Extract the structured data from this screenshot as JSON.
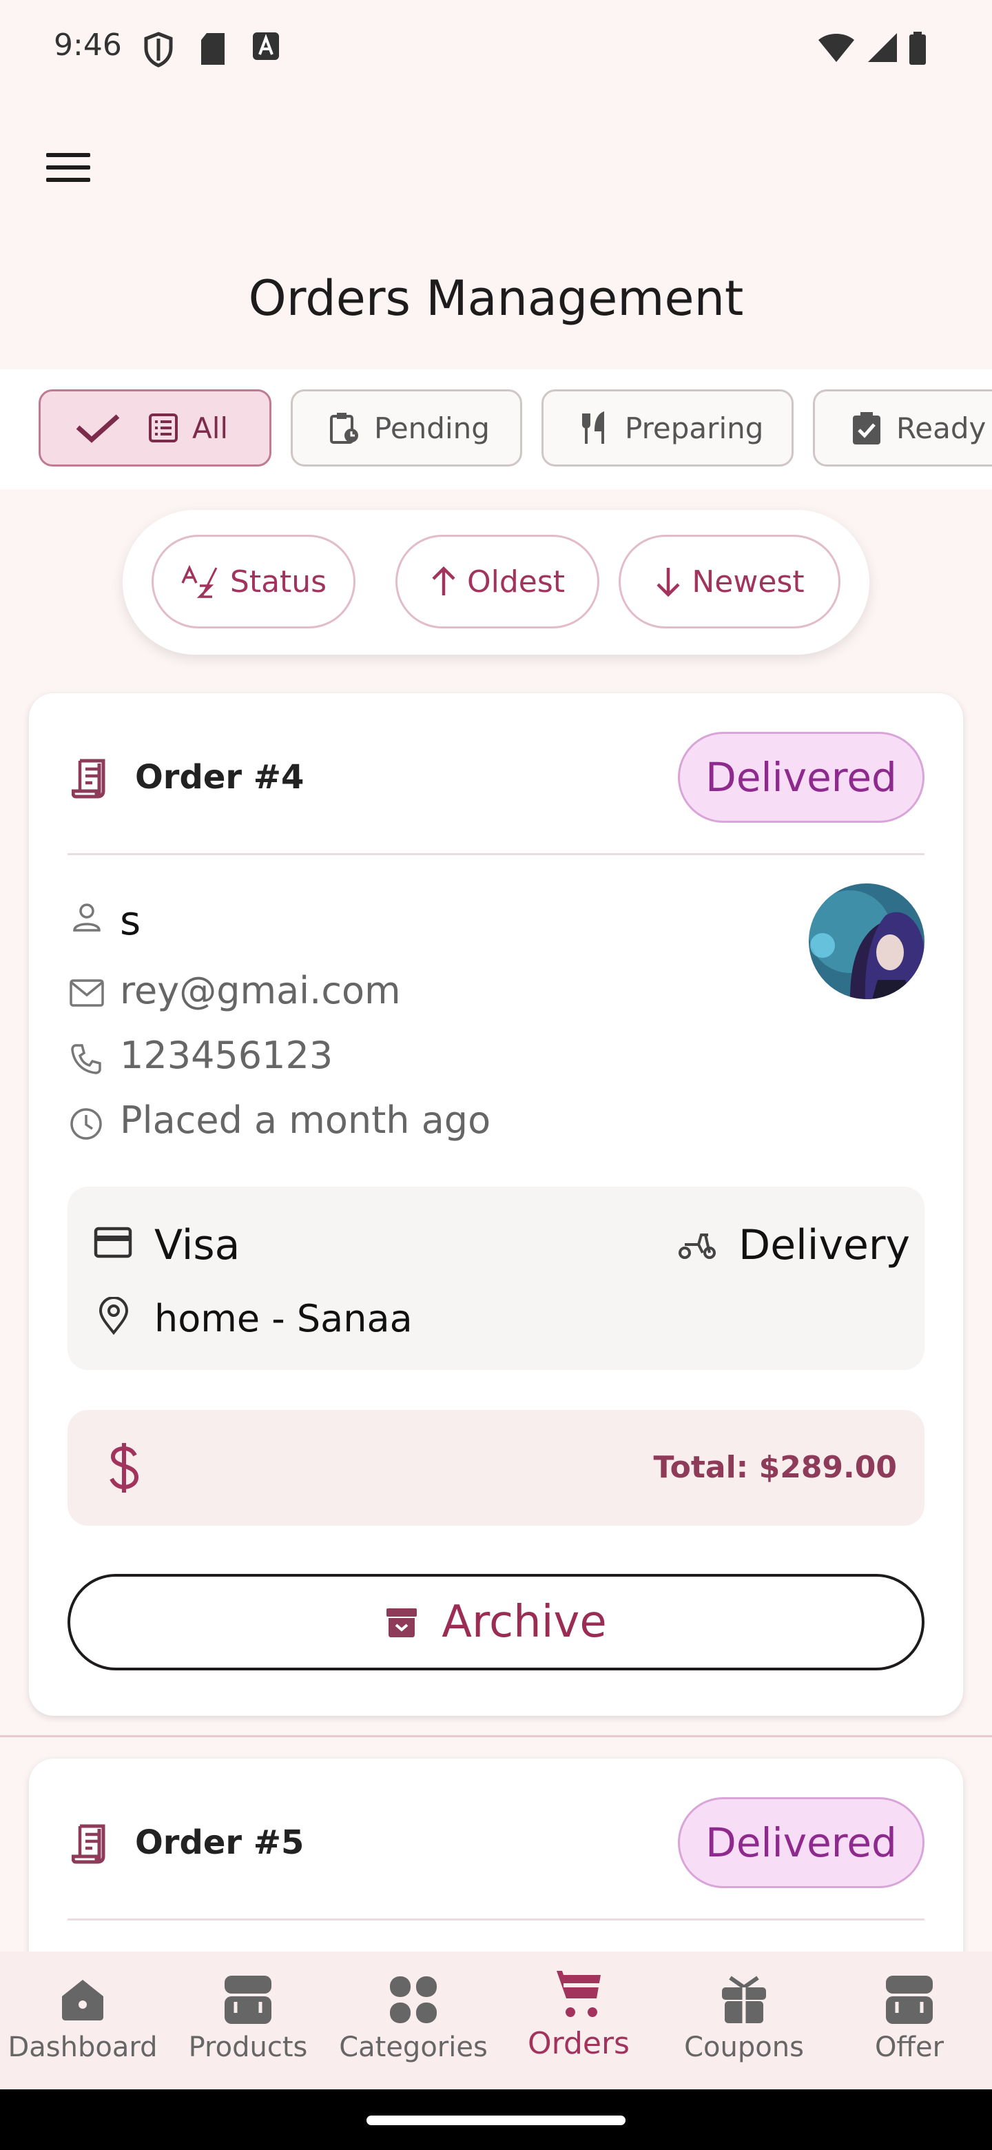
{
  "status_bar": {
    "time": "9:46"
  },
  "header": {
    "title": "Orders Management"
  },
  "tabs": [
    {
      "label": "All",
      "selected": true
    },
    {
      "label": "Pending",
      "selected": false
    },
    {
      "label": "Preparing",
      "selected": false
    },
    {
      "label": "Ready",
      "selected": false
    }
  ],
  "sort": {
    "status": "Status",
    "oldest": "Oldest",
    "newest": "Newest"
  },
  "orders": [
    {
      "title": "Order #4",
      "status": "Delivered",
      "customer_name": "s",
      "email": "rey@gmai.com",
      "phone": "123456123",
      "placed": "Placed a month ago",
      "payment": "Visa",
      "delivery": "Delivery",
      "address": "home - Sanaa",
      "total": "Total: $289.00",
      "archive_label": "Archive"
    },
    {
      "title": "Order #5",
      "status": "Delivered"
    }
  ],
  "bottom_nav": [
    {
      "label": "Dashboard",
      "icon": "home-icon"
    },
    {
      "label": "Products",
      "icon": "products-icon"
    },
    {
      "label": "Categories",
      "icon": "grid-icon"
    },
    {
      "label": "Orders",
      "icon": "cart-icon",
      "active": true
    },
    {
      "label": "Coupons",
      "icon": "gift-icon"
    },
    {
      "label": "Offer",
      "icon": "store-icon"
    }
  ],
  "colors": {
    "accent": "#A1335D",
    "badge_bg": "#F7DDF6",
    "background": "#FCF5F4"
  }
}
